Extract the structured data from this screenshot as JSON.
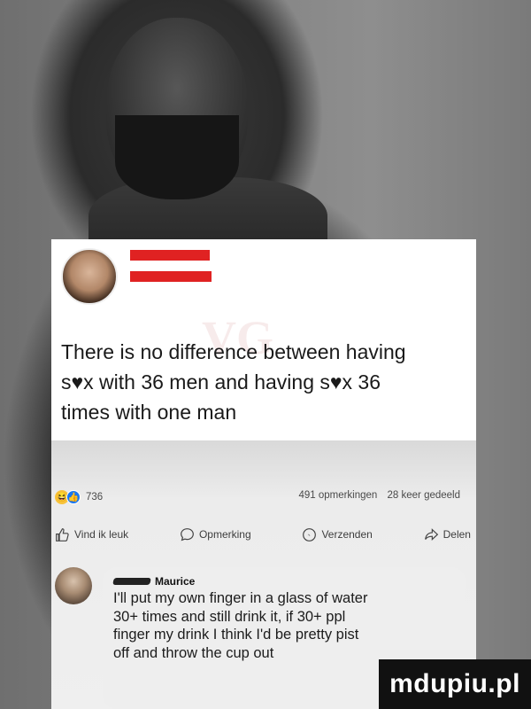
{
  "post": {
    "text_line1": "There is no difference between having",
    "text_line2": "s♥x with 36 men and having s♥x 36",
    "text_line3": "times with one man"
  },
  "stats": {
    "reaction_count": "736",
    "comments": "491 opmerkingen",
    "shares": "28 keer gedeeld"
  },
  "actions": {
    "like": "Vind ik leuk",
    "comment": "Opmerking",
    "send": "Verzenden",
    "share": "Delen"
  },
  "comment": {
    "author_last": "Maurice",
    "line1": "I'll put my own finger in a glass of water",
    "line2": "30+ times and still drink it, if 30+ ppl",
    "line3": "finger my drink I think I'd be pretty pist",
    "line4": "off and throw the cup out"
  },
  "logo": {
    "text": "mdupiu.pl"
  },
  "colors": {
    "redaction": "#e02222",
    "fb_blue": "#1877f2",
    "reaction_yellow": "#f7c33b"
  }
}
